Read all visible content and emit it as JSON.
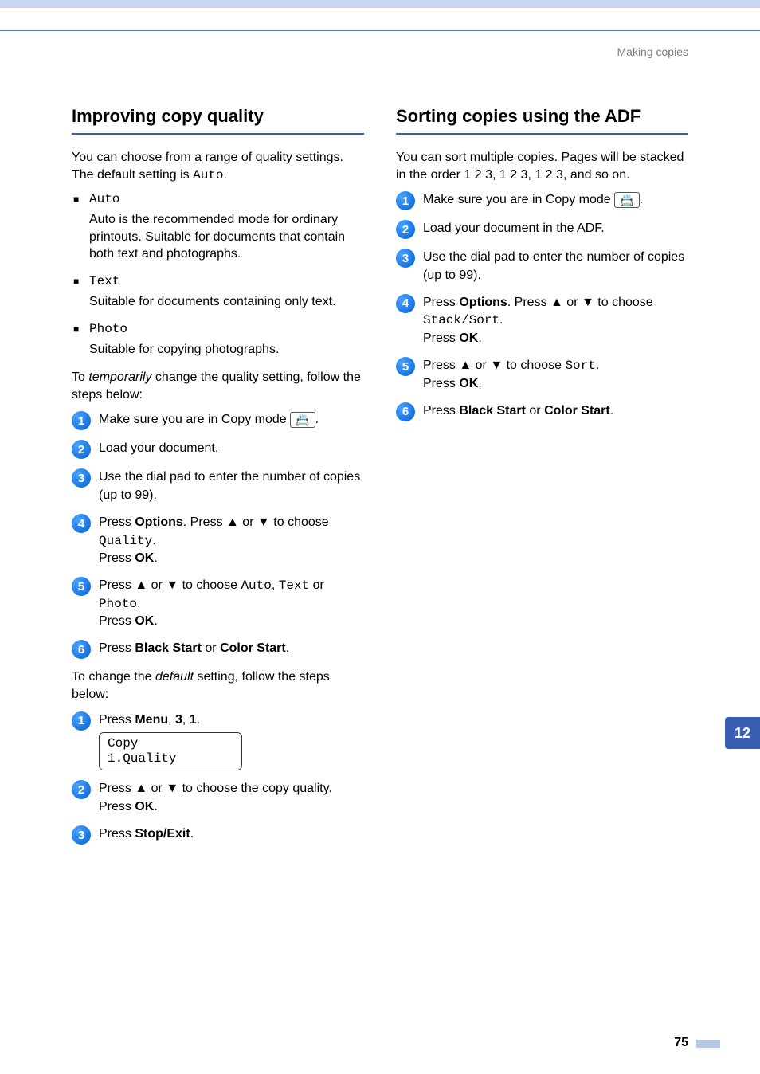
{
  "breadcrumb": "Making copies",
  "side_tab": "12",
  "page_number": "75",
  "left": {
    "heading": "Improving copy quality",
    "intro_a": "You can choose from a range of quality settings. The default setting is ",
    "intro_mono": "Auto",
    "intro_b": ".",
    "opt1_label": "Auto",
    "opt1_desc": "Auto is the recommended mode for ordinary printouts. Suitable for documents that contain both text and photographs.",
    "opt2_label": "Text",
    "opt2_desc": "Suitable for documents containing only text.",
    "opt3_label": "Photo",
    "opt3_desc": "Suitable for copying photographs.",
    "temp_a": "To ",
    "temp_i": "temporarily",
    "temp_b": " change the quality setting, follow the steps below:",
    "s1": {
      "n": "1",
      "a": "Make sure you are in Copy mode ",
      "icon": "📇",
      "b": "."
    },
    "s2": {
      "n": "2",
      "a": "Load your document."
    },
    "s3": {
      "n": "3",
      "a": "Use the dial pad to enter the number of copies (up to 99)."
    },
    "s4": {
      "n": "4",
      "a": "Press ",
      "opt": "Options",
      "b": ". Press ",
      "up": "▲",
      "c": " or ",
      "dn": "▼",
      "d": " to choose ",
      "mono": "Quality",
      "e": ".",
      "f": "Press ",
      "ok": "OK",
      "g": "."
    },
    "s5": {
      "n": "5",
      "a": "Press ",
      "up": "▲",
      "b": " or ",
      "dn": "▼",
      "c": " to choose ",
      "m1": "Auto",
      "d": ", ",
      "m2": "Text",
      "e": " or ",
      "m3": "Photo",
      "f": ".",
      "g": "Press ",
      "ok": "OK",
      "h": "."
    },
    "s6": {
      "n": "6",
      "a": "Press ",
      "b1": "Black Start",
      "b": " or ",
      "b2": "Color Start",
      "c": "."
    },
    "default_a": "To change the ",
    "default_i": "default",
    "default_b": " setting, follow the steps below:",
    "d1": {
      "n": "1",
      "a": "Press ",
      "menu": "Menu",
      "b": ", ",
      "k1": "3",
      "c": ", ",
      "k2": "1",
      "d": "."
    },
    "lcd_line1": "Copy",
    "lcd_line2": "1.Quality",
    "d2": {
      "n": "2",
      "a": "Press ",
      "up": "▲",
      "b": " or ",
      "dn": "▼",
      "c": " to choose the copy quality.",
      "d": "Press ",
      "ok": "OK",
      "e": "."
    },
    "d3": {
      "n": "3",
      "a": "Press ",
      "stop": "Stop/Exit",
      "b": "."
    }
  },
  "right": {
    "heading": "Sorting copies using the ADF",
    "intro": "You can sort multiple copies. Pages will be stacked in the order 1 2 3, 1 2 3, 1 2 3, and so on.",
    "s1": {
      "n": "1",
      "a": "Make sure you are in Copy mode ",
      "icon": "📇",
      "b": "."
    },
    "s2": {
      "n": "2",
      "a": "Load your document in the ADF."
    },
    "s3": {
      "n": "3",
      "a": "Use the dial pad to enter the number of copies (up to 99)."
    },
    "s4": {
      "n": "4",
      "a": "Press ",
      "opt": "Options",
      "b": ". Press ",
      "up": "▲",
      "c": " or ",
      "dn": "▼",
      "d": " to choose ",
      "mono": "Stack/Sort",
      "e": ".",
      "f": "Press ",
      "ok": "OK",
      "g": "."
    },
    "s5": {
      "n": "5",
      "a": "Press ",
      "up": "▲",
      "b": " or ",
      "dn": "▼",
      "c": " to choose ",
      "mono": "Sort",
      "d": ".",
      "e": "Press ",
      "ok": "OK",
      "f": "."
    },
    "s6": {
      "n": "6",
      "a": "Press ",
      "b1": "Black Start",
      "b": " or ",
      "b2": "Color Start",
      "c": "."
    }
  }
}
